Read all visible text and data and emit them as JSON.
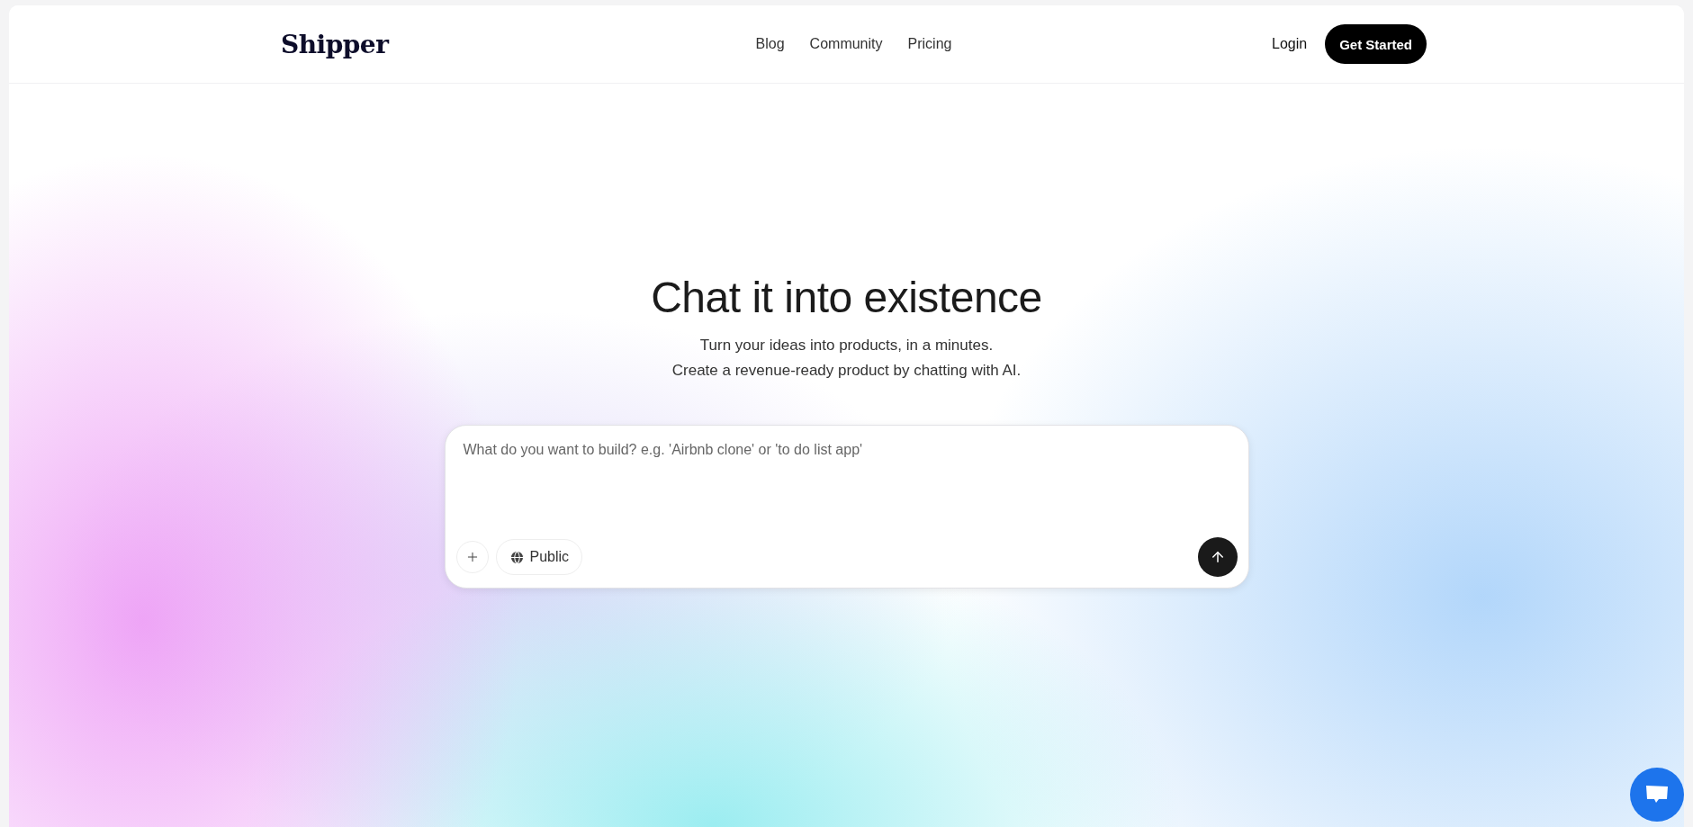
{
  "header": {
    "logo": "Shipper",
    "nav": [
      "Blog",
      "Community",
      "Pricing"
    ],
    "login": "Login",
    "cta": "Get Started"
  },
  "hero": {
    "title": "Chat it into existence",
    "subtitle_lines": [
      "Turn your ideas into products, in a minutes.",
      "Create a revenue-ready product by chatting with AI."
    ]
  },
  "prompt": {
    "placeholder": "What do you want to build? e.g. 'Airbnb clone' or 'to do list app'",
    "visibility": "Public"
  }
}
